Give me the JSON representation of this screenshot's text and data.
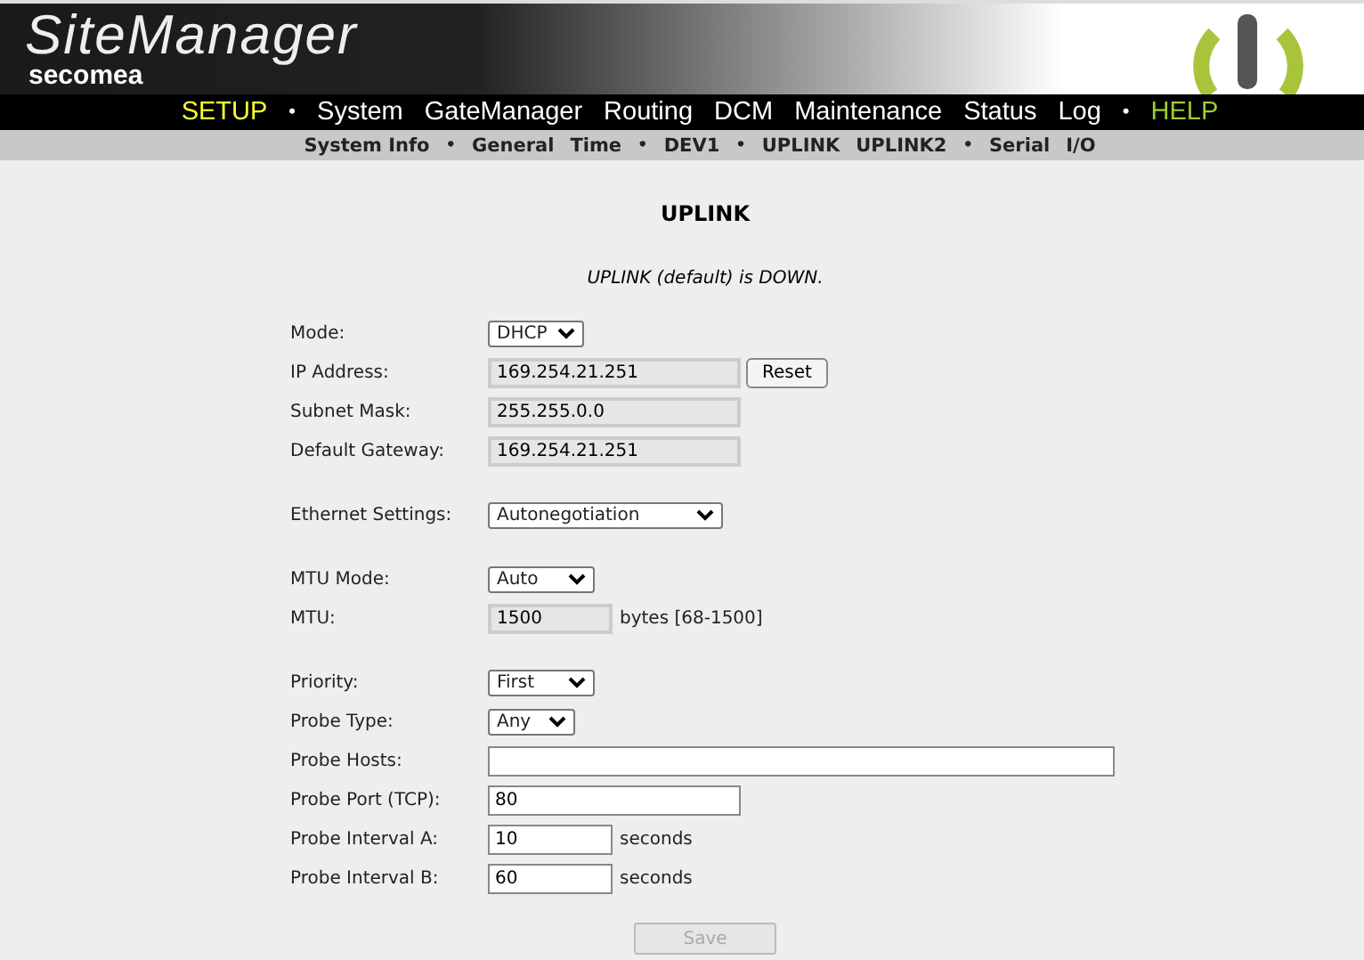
{
  "header": {
    "product": "SiteManager",
    "brand": "secomea"
  },
  "nav": [
    {
      "kind": "link",
      "label": "SETUP",
      "selected": true
    },
    {
      "kind": "sep",
      "label": "•"
    },
    {
      "kind": "link",
      "label": "System",
      "selected": false
    },
    {
      "kind": "link",
      "label": "GateManager",
      "selected": false
    },
    {
      "kind": "link",
      "label": "Routing",
      "selected": false
    },
    {
      "kind": "link",
      "label": "DCM",
      "selected": false
    },
    {
      "kind": "link",
      "label": "Maintenance",
      "selected": false
    },
    {
      "kind": "link",
      "label": "Status",
      "selected": false
    },
    {
      "kind": "link",
      "label": "Log",
      "selected": false
    },
    {
      "kind": "sep",
      "label": "•"
    },
    {
      "kind": "help",
      "label": "HELP"
    }
  ],
  "subnav": [
    {
      "kind": "link",
      "label": "System Info"
    },
    {
      "kind": "sep",
      "label": "•"
    },
    {
      "kind": "link",
      "label": "General"
    },
    {
      "kind": "link",
      "label": "Time"
    },
    {
      "kind": "sep",
      "label": "•"
    },
    {
      "kind": "link",
      "label": "DEV1"
    },
    {
      "kind": "sep",
      "label": "•"
    },
    {
      "kind": "link",
      "label": "UPLINK"
    },
    {
      "kind": "link",
      "label": "UPLINK2"
    },
    {
      "kind": "sep",
      "label": "•"
    },
    {
      "kind": "link",
      "label": "Serial"
    },
    {
      "kind": "link",
      "label": "I/O"
    }
  ],
  "page_title": "UPLINK",
  "status_message": "UPLINK (default) is DOWN.",
  "groups": [
    [
      {
        "label": "Mode:",
        "kind": "select",
        "value": "DHCP"
      },
      {
        "label": "IP Address:",
        "kind": "readonly",
        "value": "169.254.21.251",
        "button": "Reset"
      },
      {
        "label": "Subnet Mask:",
        "kind": "readonly",
        "value": "255.255.0.0"
      },
      {
        "label": "Default Gateway:",
        "kind": "readonly",
        "value": "169.254.21.251"
      }
    ],
    [
      {
        "label": "Ethernet Settings:",
        "kind": "select",
        "value": "Autonegotiation"
      }
    ],
    [
      {
        "label": "MTU Mode:",
        "kind": "select",
        "value": "Auto"
      },
      {
        "label": "MTU:",
        "kind": "readonly",
        "value": "1500",
        "suffix": "bytes [68-1500]"
      }
    ],
    [
      {
        "label": "Priority:",
        "kind": "select",
        "value": "First"
      },
      {
        "label": "Probe Type:",
        "kind": "select",
        "value": "Any"
      },
      {
        "label": "Probe Hosts:",
        "kind": "text"
      },
      {
        "label": "Probe Port (TCP):",
        "kind": "text",
        "value": "80"
      },
      {
        "label": "Probe Interval A:",
        "kind": "text",
        "value": "10",
        "suffix": "seconds"
      },
      {
        "label": "Probe Interval B:",
        "kind": "text",
        "value": "60",
        "suffix": "seconds"
      }
    ]
  ],
  "save_button": {
    "label": "Save",
    "disabled": true
  }
}
